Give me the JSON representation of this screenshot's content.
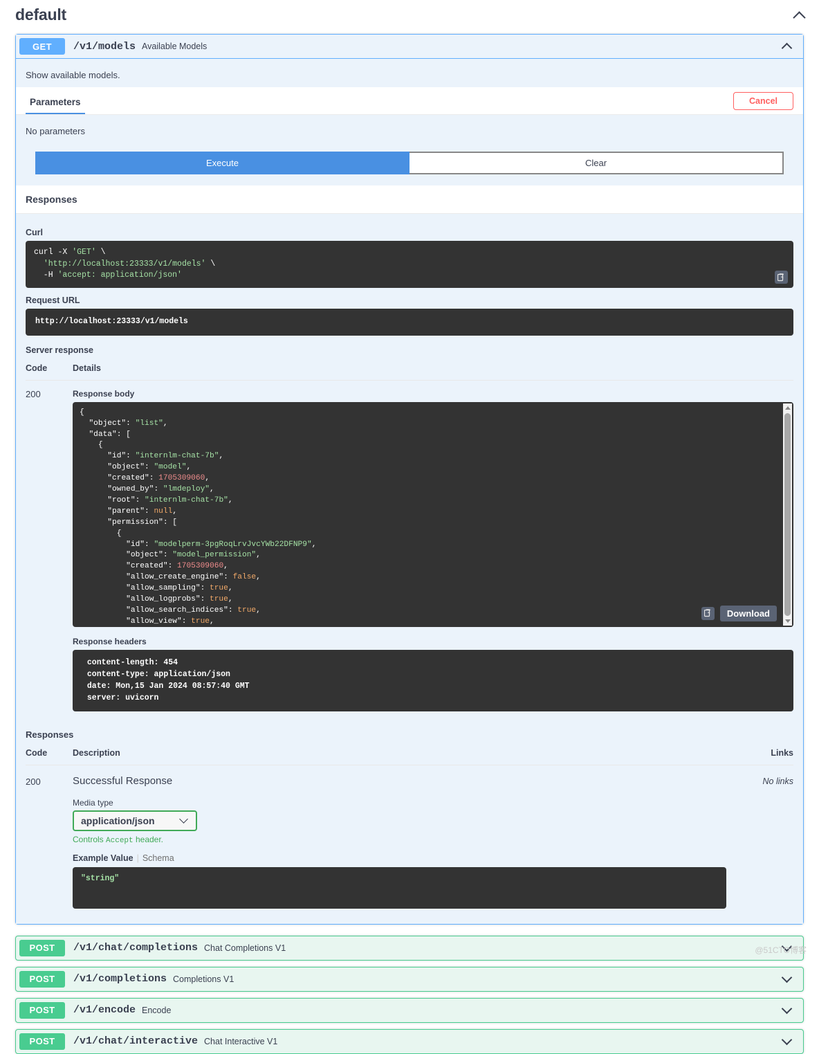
{
  "tag": {
    "title": "default",
    "collapse_icon": "chevron-up-icon"
  },
  "operation": {
    "method": "GET",
    "path": "/v1/models",
    "summary": "Available Models",
    "description": "Show available models.",
    "tabs": [
      {
        "label": "Parameters",
        "active": true
      }
    ],
    "cancel_label": "Cancel",
    "no_parameters": "No parameters",
    "execute_label": "Execute",
    "clear_label": "Clear",
    "responses_heading": "Responses",
    "curl_label": "Curl",
    "curl_command": "curl -X 'GET' \\\n  'http://localhost:23333/v1/models' \\\n  -H 'accept: application/json'",
    "curl_lines": [
      {
        "plain": "curl -X ",
        "green": "'GET'",
        "tail": " \\"
      },
      {
        "plain": "  ",
        "green": "'http://localhost:23333/v1/models'",
        "tail": " \\"
      },
      {
        "plain": "  -H ",
        "green": "'accept: application/json'",
        "tail": ""
      }
    ],
    "request_url_label": "Request URL",
    "request_url": "http://localhost:23333/v1/models",
    "server_response_label": "Server response",
    "server_table_headers": {
      "code": "Code",
      "details": "Details"
    },
    "server_status_code": "200",
    "response_body_label": "Response body",
    "response_body": "{\n  \"object\": \"list\",\n  \"data\": [\n    {\n      \"id\": \"internlm-chat-7b\",\n      \"object\": \"model\",\n      \"created\": 1705309060,\n      \"owned_by\": \"lmdeploy\",\n      \"root\": \"internlm-chat-7b\",\n      \"parent\": null,\n      \"permission\": [\n        {\n          \"id\": \"modelperm-3pgRoqLrvJvcYWb22DFNP9\",\n          \"object\": \"model_permission\",\n          \"created\": 1705309060,\n          \"allow_create_engine\": false,\n          \"allow_sampling\": true,\n          \"allow_logprobs\": true,\n          \"allow_search_indices\": true,\n          \"allow_view\": true,\n          \"allow_fine_tuning\": false,\n          \"organization\": \"*\",\n          \"group\": null,\n          \"is_blocking\": false\n        }\n      ]\n    }\n  ]\n}",
    "download_label": "Download",
    "copy_icon": "copy-to-clipboard-icon",
    "response_headers_label": "Response headers",
    "response_headers": " content-length: 454 \n content-type: application/json \n date: Mon,15 Jan 2024 08:57:40 GMT \n server: uvicorn ",
    "responses2_heading": "Responses",
    "responses2_headers": {
      "code": "Code",
      "description": "Description",
      "links": "Links"
    },
    "responses2_rows": [
      {
        "code": "200",
        "description": "Successful Response",
        "links": "No links",
        "media_type_label": "Media type",
        "media_type_value": "application/json",
        "media_type_options": [
          "application/json"
        ],
        "controls_accept_prefix": "Controls ",
        "controls_accept_code": "Accept",
        "controls_accept_suffix": " header.",
        "example_tab": "Example Value",
        "schema_tab": "Schema",
        "example_value": "\"string\""
      }
    ]
  },
  "collapsed_operations": [
    {
      "method": "POST",
      "path": "/v1/chat/completions",
      "summary": "Chat Completions V1"
    },
    {
      "method": "POST",
      "path": "/v1/completions",
      "summary": "Completions V1"
    },
    {
      "method": "POST",
      "path": "/v1/encode",
      "summary": "Encode"
    },
    {
      "method": "POST",
      "path": "/v1/chat/interactive",
      "summary": "Chat Interactive V1"
    }
  ],
  "watermark": "@51CTO博客",
  "colors": {
    "get": "#61affe",
    "post": "#49cc90",
    "execute": "#4990e2",
    "cancel": "#ff6060",
    "media_border": "#41aa58",
    "body_bg": "#333333"
  }
}
